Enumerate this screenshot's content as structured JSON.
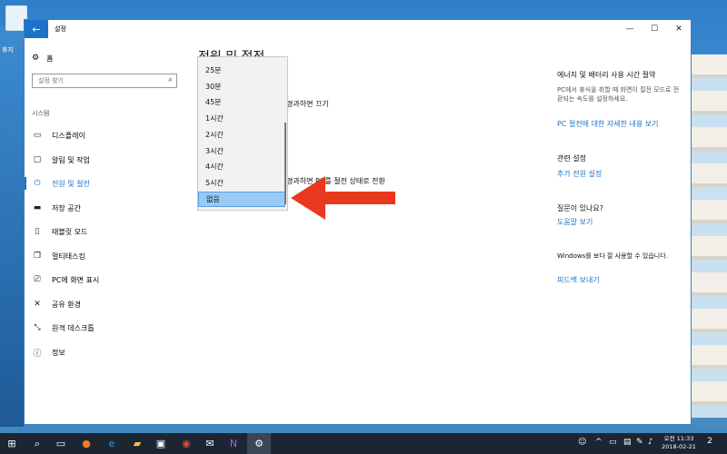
{
  "window": {
    "title": "설정",
    "back_icon": "back-arrow-icon",
    "minimize_glyph": "—",
    "maximize_glyph": "☐",
    "close_glyph": "✕"
  },
  "desktop": {
    "recycle_bin_label": "휴지"
  },
  "sidebar": {
    "home_label": "홈",
    "search_placeholder": "설정 찾기",
    "section_label": "시스템",
    "items": [
      {
        "label": "디스플레이",
        "icon": "monitor-icon",
        "glyph": "▭",
        "active": false
      },
      {
        "label": "알림 및 작업",
        "icon": "notification-icon",
        "glyph": "▢",
        "active": false
      },
      {
        "label": "전원 및 절전",
        "icon": "power-icon",
        "glyph": "⏻",
        "active": true
      },
      {
        "label": "저장 공간",
        "icon": "storage-icon",
        "glyph": "▬",
        "active": false
      },
      {
        "label": "태블릿 모드",
        "icon": "tablet-icon",
        "glyph": "▯",
        "active": false
      },
      {
        "label": "멀티태스킹",
        "icon": "multitask-icon",
        "glyph": "❐",
        "active": false
      },
      {
        "label": "PC에 화면 표시",
        "icon": "project-icon",
        "glyph": "⎚",
        "active": false
      },
      {
        "label": "공유 환경",
        "icon": "share-icon",
        "glyph": "✕",
        "active": false
      },
      {
        "label": "원격 데스크톱",
        "icon": "remote-desktop-icon",
        "glyph": "⤡",
        "active": false
      },
      {
        "label": "정보",
        "icon": "info-icon",
        "glyph": "ⓘ",
        "active": false
      }
    ]
  },
  "main": {
    "title_partial": "전원 및 절전",
    "screen_text_partial": "경과하면 끄기",
    "sleep_text_partial": "경과하면 PC를 절전 상태로 전환"
  },
  "dropdown": {
    "options": [
      "25분",
      "30분",
      "45분",
      "1시간",
      "2시간",
      "3시간",
      "4시간",
      "5시간",
      "없음"
    ],
    "selected": "없음"
  },
  "right_panel": {
    "energy_heading": "에너지 및 배터리 사용 시간 절약",
    "energy_text": "PC에서 휴식을 취할 때 화면이 절전 모드로 전환되는 속도를 설정하세요.",
    "energy_link": "PC 절전에 대한 자세한 내용 보기",
    "related_heading": "관련 설정",
    "related_link": "추가 전원 설정",
    "question_heading": "질문이 있나요?",
    "question_link": "도움말 보기",
    "improve_heading": "Windows를 보다 잘 사용할 수 있습니다.",
    "improve_link": "피드백 보내기"
  },
  "taskbar": {
    "clock_period_time": "오전 11:33",
    "date": "2018-02-21",
    "notification_count": "2",
    "colors": {
      "background": "#1c2633",
      "accent": "#1e73c9"
    }
  },
  "annotation": {
    "arrow_color": "#e8391f"
  }
}
